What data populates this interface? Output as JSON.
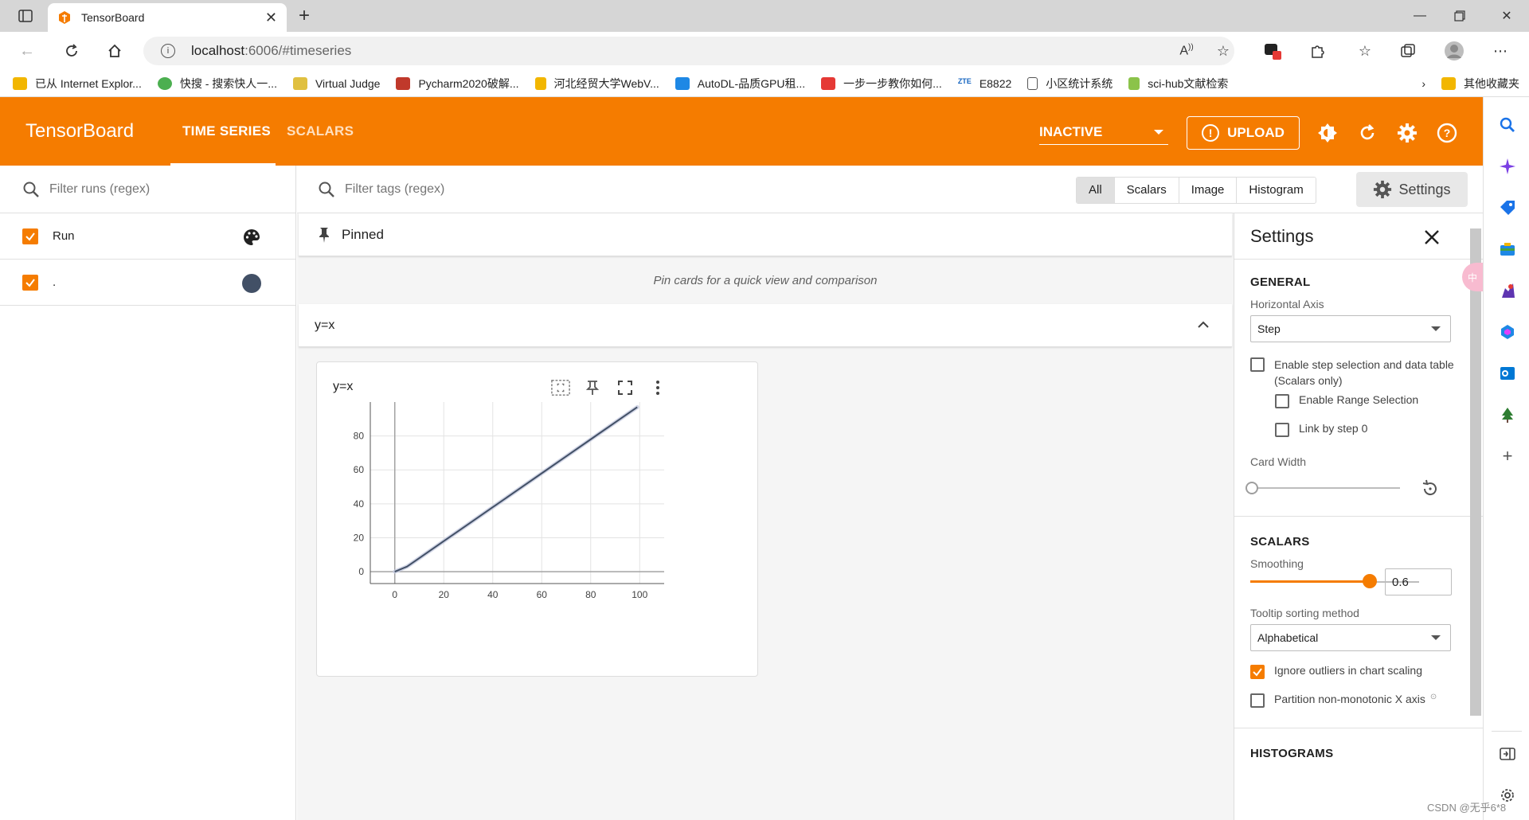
{
  "browser": {
    "tab_title": "TensorBoard",
    "url_host": "localhost",
    "url_path": ":6006/#timeseries",
    "bookmarks": [
      "已从 Internet Explor...",
      "快搜 - 搜索快人一...",
      "Virtual Judge",
      "Pycharm2020破解...",
      "河北经贸大学WebV...",
      "AutoDL-品质GPU租...",
      "一步一步教你如何...",
      "E8822",
      "小区统计系统",
      "sci-hub文献检索",
      "其他收藏夹"
    ],
    "bookmark_colors": [
      "#f2b600",
      "#4caf50",
      "#333333",
      "#c0392b",
      "#f2b600",
      "#1e88e5",
      "#e53935",
      "#1565c0",
      "#666666",
      "#8bc34a",
      "#f2b600"
    ]
  },
  "header": {
    "brand": "TensorBoard",
    "tabs": [
      "TIME SERIES",
      "SCALARS"
    ],
    "run_select": "INACTIVE",
    "upload_label": "UPLOAD",
    "accent": "#f57c00"
  },
  "runs": {
    "filter_placeholder": "Filter runs (regex)",
    "items": [
      {
        "label": "Run",
        "checked": true,
        "icon": "palette-icon"
      },
      {
        "label": ".",
        "checked": true,
        "color": "#425066"
      }
    ]
  },
  "main": {
    "tag_filter_placeholder": "Filter tags (regex)",
    "type_filters": [
      "All",
      "Scalars",
      "Image",
      "Histogram"
    ],
    "selected_type_filter": "All",
    "settings_button": "Settings",
    "pinned_title": "Pinned",
    "pinned_hint": "Pin cards for a quick view and comparison",
    "group_title": "y=x",
    "card_title": "y=x"
  },
  "chart_data": {
    "type": "line",
    "title": "y=x",
    "xlabel": "",
    "ylabel": "",
    "xlim": [
      -10,
      110
    ],
    "ylim": [
      -7,
      100
    ],
    "xticks": [
      0,
      20,
      40,
      60,
      80,
      100
    ],
    "yticks": [
      0,
      20,
      40,
      60,
      80
    ],
    "grid": true,
    "series": [
      {
        "values_x": [
          0,
          5,
          10,
          20,
          30,
          40,
          50,
          60,
          70,
          80,
          90,
          99
        ],
        "values_y": [
          0,
          3,
          8,
          18,
          28,
          38,
          48,
          58,
          68,
          78,
          88,
          97
        ],
        "color": "#425066"
      }
    ],
    "raw_series_color": "#c5cbe0"
  },
  "settings": {
    "title": "Settings",
    "general": {
      "heading": "GENERAL",
      "horizontal_axis_label": "Horizontal Axis",
      "horizontal_axis_value": "Step",
      "step_selection_label": "Enable step selection and data table",
      "step_selection_sub": "(Scalars only)",
      "range_selection_label": "Enable Range Selection",
      "link_by_step_label": "Link by step 0",
      "card_width_label": "Card Width"
    },
    "scalars": {
      "heading": "SCALARS",
      "smoothing_label": "Smoothing",
      "smoothing_value": "0.6",
      "tooltip_label": "Tooltip sorting method",
      "tooltip_value": "Alphabetical",
      "ignore_outliers_label": "Ignore outliers in chart scaling",
      "partition_label": "Partition non-monotonic X axis"
    },
    "histograms": {
      "heading": "HISTOGRAMS"
    }
  },
  "watermark": "CSDN @无乎6*8"
}
